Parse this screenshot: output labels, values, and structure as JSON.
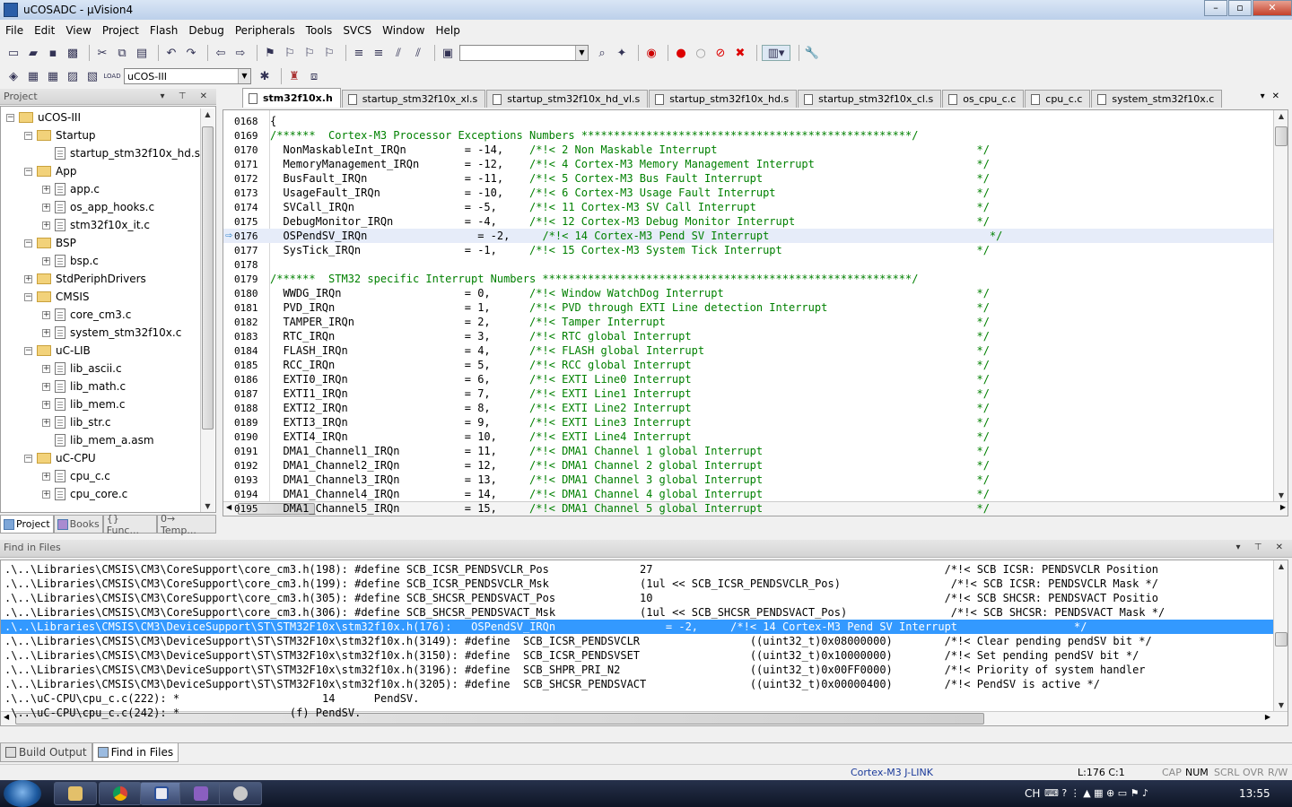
{
  "window": {
    "title": "uCOSADC - µVision4",
    "min": "–",
    "max": "▫",
    "close": "✕"
  },
  "menu": [
    "File",
    "Edit",
    "View",
    "Project",
    "Flash",
    "Debug",
    "Peripherals",
    "Tools",
    "SVCS",
    "Window",
    "Help"
  ],
  "toolbar": {
    "target_combo": "uCOS-III",
    "find_combo": ""
  },
  "project_panel": {
    "header": "Project",
    "tree": [
      {
        "label": "uCOS-III",
        "level": 0,
        "type": "root",
        "exp": "−"
      },
      {
        "label": "Startup",
        "level": 1,
        "type": "folder",
        "exp": "−"
      },
      {
        "label": "startup_stm32f10x_hd.s",
        "level": 2,
        "type": "file",
        "exp": ""
      },
      {
        "label": "App",
        "level": 1,
        "type": "folder",
        "exp": "−"
      },
      {
        "label": "app.c",
        "level": 2,
        "type": "file",
        "exp": "+"
      },
      {
        "label": "os_app_hooks.c",
        "level": 2,
        "type": "file",
        "exp": "+"
      },
      {
        "label": "stm32f10x_it.c",
        "level": 2,
        "type": "file",
        "exp": "+"
      },
      {
        "label": "BSP",
        "level": 1,
        "type": "folder",
        "exp": "−"
      },
      {
        "label": "bsp.c",
        "level": 2,
        "type": "file",
        "exp": "+"
      },
      {
        "label": "StdPeriphDrivers",
        "level": 1,
        "type": "folder",
        "exp": "+"
      },
      {
        "label": "CMSIS",
        "level": 1,
        "type": "folder",
        "exp": "−"
      },
      {
        "label": "core_cm3.c",
        "level": 2,
        "type": "file",
        "exp": "+"
      },
      {
        "label": "system_stm32f10x.c",
        "level": 2,
        "type": "file",
        "exp": "+"
      },
      {
        "label": "uC-LIB",
        "level": 1,
        "type": "folder",
        "exp": "−"
      },
      {
        "label": "lib_ascii.c",
        "level": 2,
        "type": "file",
        "exp": "+"
      },
      {
        "label": "lib_math.c",
        "level": 2,
        "type": "file",
        "exp": "+"
      },
      {
        "label": "lib_mem.c",
        "level": 2,
        "type": "file",
        "exp": "+"
      },
      {
        "label": "lib_str.c",
        "level": 2,
        "type": "file",
        "exp": "+"
      },
      {
        "label": "lib_mem_a.asm",
        "level": 2,
        "type": "file",
        "exp": ""
      },
      {
        "label": "uC-CPU",
        "level": 1,
        "type": "folder",
        "exp": "−"
      },
      {
        "label": "cpu_c.c",
        "level": 2,
        "type": "file",
        "exp": "+"
      },
      {
        "label": "cpu_core.c",
        "level": 2,
        "type": "file",
        "exp": "+"
      }
    ],
    "tabs": [
      "Project",
      "Books",
      "{} Func...",
      "0→ Temp..."
    ]
  },
  "editor_tabs": [
    {
      "label": "stm32f10x.h",
      "active": true
    },
    {
      "label": "startup_stm32f10x_xl.s",
      "active": false
    },
    {
      "label": "startup_stm32f10x_hd_vl.s",
      "active": false
    },
    {
      "label": "startup_stm32f10x_hd.s",
      "active": false
    },
    {
      "label": "startup_stm32f10x_cl.s",
      "active": false
    },
    {
      "label": "os_cpu_c.c",
      "active": false
    },
    {
      "label": "cpu_c.c",
      "active": false
    },
    {
      "label": "system_stm32f10x.c",
      "active": false
    }
  ],
  "code": [
    {
      "ln": "0168",
      "code": "{",
      "comment": ""
    },
    {
      "ln": "0169",
      "code": "",
      "comment": "/******  Cortex-M3 Processor Exceptions Numbers ***************************************************/"
    },
    {
      "ln": "0170",
      "code": "  NonMaskableInt_IRQn         = -14,    ",
      "comment": "/*!< 2 Non Maskable Interrupt                                        */"
    },
    {
      "ln": "0171",
      "code": "  MemoryManagement_IRQn       = -12,    ",
      "comment": "/*!< 4 Cortex-M3 Memory Management Interrupt                         */"
    },
    {
      "ln": "0172",
      "code": "  BusFault_IRQn               = -11,    ",
      "comment": "/*!< 5 Cortex-M3 Bus Fault Interrupt                                 */"
    },
    {
      "ln": "0173",
      "code": "  UsageFault_IRQn             = -10,    ",
      "comment": "/*!< 6 Cortex-M3 Usage Fault Interrupt                               */"
    },
    {
      "ln": "0174",
      "code": "  SVCall_IRQn                 = -5,     ",
      "comment": "/*!< 11 Cortex-M3 SV Call Interrupt                                  */"
    },
    {
      "ln": "0175",
      "code": "  DebugMonitor_IRQn           = -4,     ",
      "comment": "/*!< 12 Cortex-M3 Debug Monitor Interrupt                            */"
    },
    {
      "ln": "0176",
      "code": "  OSPendSV_IRQn                 = -2,     ",
      "comment": "/*!< 14 Cortex-M3 Pend SV Interrupt                                  */",
      "current": true
    },
    {
      "ln": "0177",
      "code": "  SysTick_IRQn                = -1,     ",
      "comment": "/*!< 15 Cortex-M3 System Tick Interrupt                              */"
    },
    {
      "ln": "0178",
      "code": "",
      "comment": ""
    },
    {
      "ln": "0179",
      "code": "",
      "comment": "/******  STM32 specific Interrupt Numbers *********************************************************/"
    },
    {
      "ln": "0180",
      "code": "  WWDG_IRQn                   = 0,      ",
      "comment": "/*!< Window WatchDog Interrupt                                       */"
    },
    {
      "ln": "0181",
      "code": "  PVD_IRQn                    = 1,      ",
      "comment": "/*!< PVD through EXTI Line detection Interrupt                       */"
    },
    {
      "ln": "0182",
      "code": "  TAMPER_IRQn                 = 2,      ",
      "comment": "/*!< Tamper Interrupt                                                */"
    },
    {
      "ln": "0183",
      "code": "  RTC_IRQn                    = 3,      ",
      "comment": "/*!< RTC global Interrupt                                            */"
    },
    {
      "ln": "0184",
      "code": "  FLASH_IRQn                  = 4,      ",
      "comment": "/*!< FLASH global Interrupt                                          */"
    },
    {
      "ln": "0185",
      "code": "  RCC_IRQn                    = 5,      ",
      "comment": "/*!< RCC global Interrupt                                            */"
    },
    {
      "ln": "0186",
      "code": "  EXTI0_IRQn                  = 6,      ",
      "comment": "/*!< EXTI Line0 Interrupt                                            */"
    },
    {
      "ln": "0187",
      "code": "  EXTI1_IRQn                  = 7,      ",
      "comment": "/*!< EXTI Line1 Interrupt                                            */"
    },
    {
      "ln": "0188",
      "code": "  EXTI2_IRQn                  = 8,      ",
      "comment": "/*!< EXTI Line2 Interrupt                                            */"
    },
    {
      "ln": "0189",
      "code": "  EXTI3_IRQn                  = 9,      ",
      "comment": "/*!< EXTI Line3 Interrupt                                            */"
    },
    {
      "ln": "0190",
      "code": "  EXTI4_IRQn                  = 10,     ",
      "comment": "/*!< EXTI Line4 Interrupt                                            */"
    },
    {
      "ln": "0191",
      "code": "  DMA1_Channel1_IRQn          = 11,     ",
      "comment": "/*!< DMA1 Channel 1 global Interrupt                                 */"
    },
    {
      "ln": "0192",
      "code": "  DMA1_Channel2_IRQn          = 12,     ",
      "comment": "/*!< DMA1 Channel 2 global Interrupt                                 */"
    },
    {
      "ln": "0193",
      "code": "  DMA1_Channel3_IRQn          = 13,     ",
      "comment": "/*!< DMA1 Channel 3 global Interrupt                                 */"
    },
    {
      "ln": "0194",
      "code": "  DMA1_Channel4_IRQn          = 14,     ",
      "comment": "/*!< DMA1 Channel 4 global Interrupt                                 */"
    },
    {
      "ln": "0195",
      "code": "  DMA1_Channel5_IRQn          = 15,     ",
      "comment": "/*!< DMA1 Channel 5 global Interrupt                                 */"
    }
  ],
  "find_panel": {
    "header": "Find in Files",
    "lines": [
      {
        "text": ".\\..\\Libraries\\CMSIS\\CM3\\CoreSupport\\core_cm3.h(198): #define SCB_ICSR_PENDSVCLR_Pos              27                                             /*!< SCB ICSR: PENDSVCLR Position"
      },
      {
        "text": ".\\..\\Libraries\\CMSIS\\CM3\\CoreSupport\\core_cm3.h(199): #define SCB_ICSR_PENDSVCLR_Msk              (1ul << SCB_ICSR_PENDSVCLR_Pos)                 /*!< SCB ICSR: PENDSVCLR Mask */"
      },
      {
        "text": ".\\..\\Libraries\\CMSIS\\CM3\\CoreSupport\\core_cm3.h(305): #define SCB_SHCSR_PENDSVACT_Pos             10                                             /*!< SCB SHCSR: PENDSVACT Positio"
      },
      {
        "text": ".\\..\\Libraries\\CMSIS\\CM3\\CoreSupport\\core_cm3.h(306): #define SCB_SHCSR_PENDSVACT_Msk             (1ul << SCB_SHCSR_PENDSVACT_Pos)                /*!< SCB SHCSR: PENDSVACT Mask */"
      },
      {
        "text": ".\\..\\Libraries\\CMSIS\\CM3\\DeviceSupport\\ST\\STM32F10x\\stm32f10x.h(176):   OSPendSV_IRQn                 = -2,     /*!< 14 Cortex-M3 Pend SV Interrupt                  */",
        "selected": true
      },
      {
        "text": ".\\..\\Libraries\\CMSIS\\CM3\\DeviceSupport\\ST\\STM32F10x\\stm32f10x.h(3149): #define  SCB_ICSR_PENDSVCLR                 ((uint32_t)0x08000000)        /*!< Clear pending pendSV bit */"
      },
      {
        "text": ".\\..\\Libraries\\CMSIS\\CM3\\DeviceSupport\\ST\\STM32F10x\\stm32f10x.h(3150): #define  SCB_ICSR_PENDSVSET                 ((uint32_t)0x10000000)        /*!< Set pending pendSV bit */"
      },
      {
        "text": ".\\..\\Libraries\\CMSIS\\CM3\\DeviceSupport\\ST\\STM32F10x\\stm32f10x.h(3196): #define  SCB_SHPR_PRI_N2                    ((uint32_t)0x00FF0000)        /*!< Priority of system handler"
      },
      {
        "text": ".\\..\\Libraries\\CMSIS\\CM3\\DeviceSupport\\ST\\STM32F10x\\stm32f10x.h(3205): #define  SCB_SHCSR_PENDSVACT                ((uint32_t)0x00000400)        /*!< PendSV is active */"
      },
      {
        "text": ".\\..\\uC-CPU\\cpu_c.c(222): *                      14      PendSV."
      },
      {
        "text": ".\\..\\uC-CPU\\cpu_c.c(242): *                 (f) PendSV."
      }
    ]
  },
  "bottom_tabs": [
    {
      "label": "Build Output",
      "active": false
    },
    {
      "label": "Find in Files",
      "active": true
    }
  ],
  "status": {
    "debugger": "Cortex-M3 J-LINK",
    "position": "L:176 C:1",
    "cap": "CAP",
    "num": "NUM",
    "scrl": "SCRL",
    "ovr": "OVR",
    "rw": "R/W"
  },
  "taskbar": {
    "lang": "CH",
    "clock": "13:55"
  }
}
